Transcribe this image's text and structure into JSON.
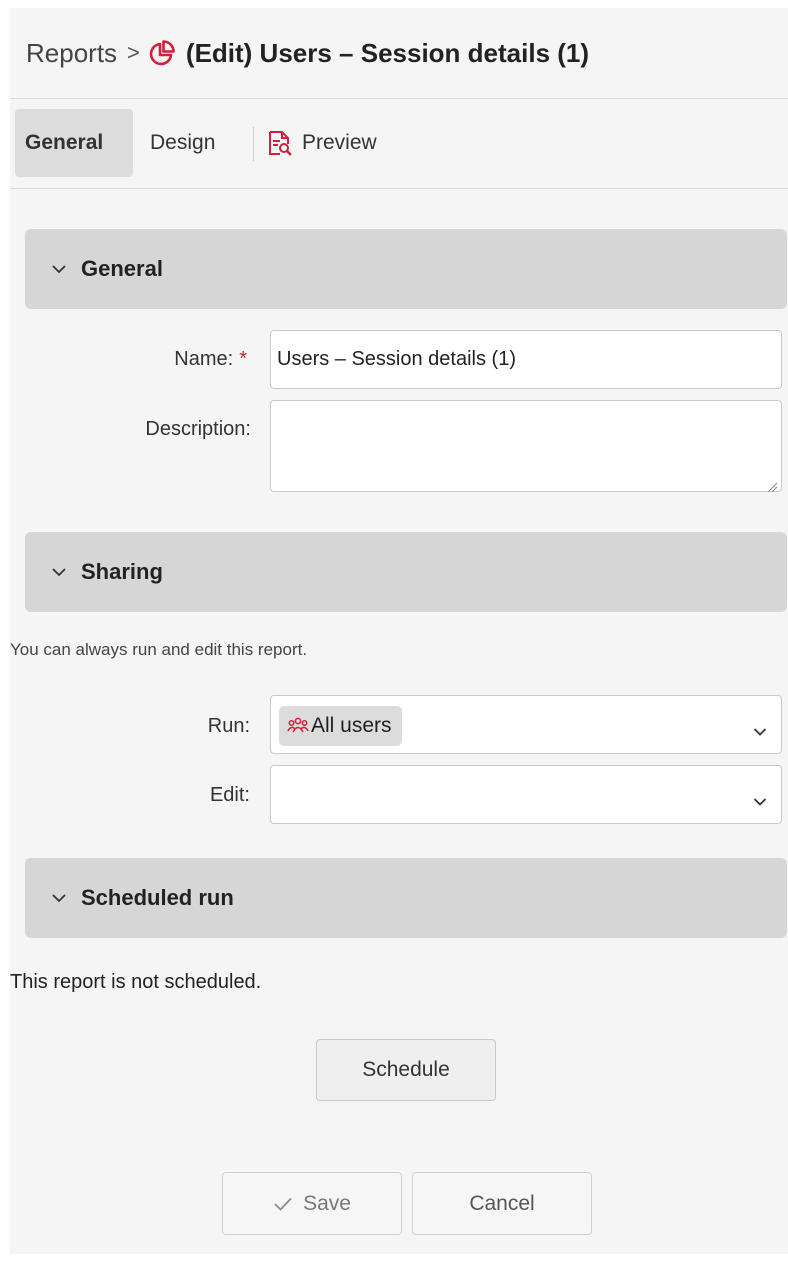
{
  "header": {
    "breadcrumb_root": "Reports",
    "breadcrumb_separator": ">",
    "title": "(Edit) Users – Session details (1)",
    "title_icon": "pie-chart-icon",
    "accent_color": "#d11f3d"
  },
  "tabs": {
    "general": "General",
    "design": "Design",
    "preview": "Preview",
    "preview_icon": "document-search-icon",
    "active": "General"
  },
  "general_section": {
    "title": "General",
    "name_label": "Name:",
    "name_required_mark": "*",
    "name_value": "Users – Session details (1)",
    "description_label": "Description:",
    "description_value": ""
  },
  "sharing_section": {
    "title": "Sharing",
    "note": "You can always run and edit this report.",
    "run_label": "Run:",
    "run_value": "All users",
    "run_value_icon": "users-group-icon",
    "edit_label": "Edit:",
    "edit_value": ""
  },
  "scheduled_section": {
    "title": "Scheduled run",
    "status": "This report is not scheduled.",
    "schedule_button": "Schedule"
  },
  "footer": {
    "save_label": "Save",
    "cancel_label": "Cancel"
  }
}
